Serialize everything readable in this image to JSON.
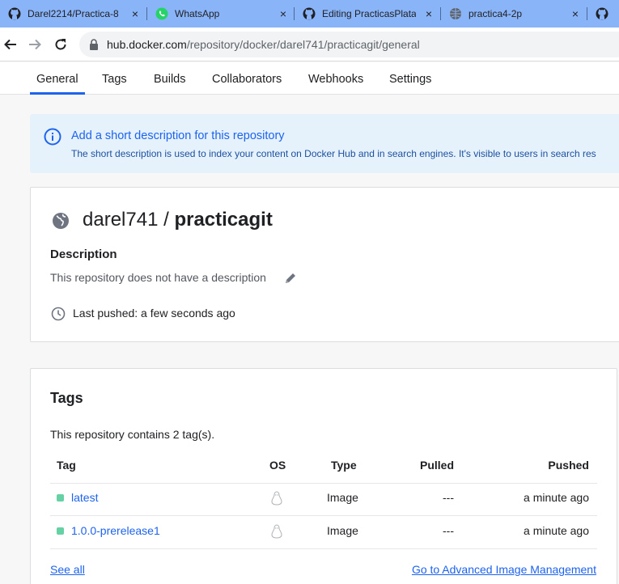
{
  "browser": {
    "tabs": [
      {
        "title": "Darel2214/Practica-8",
        "icon": "github-icon"
      },
      {
        "title": "WhatsApp",
        "icon": "whatsapp-icon"
      },
      {
        "title": "Editing PracticasPlata",
        "icon": "github-icon"
      },
      {
        "title": "practica4-2p",
        "icon": "globe-icon"
      }
    ],
    "close_glyph": "×",
    "url_host": "hub.docker.com",
    "url_path": "/repository/docker/darel741/practicagit/general"
  },
  "repo_nav": {
    "tabs": [
      "General",
      "Tags",
      "Builds",
      "Collaborators",
      "Webhooks",
      "Settings"
    ],
    "active": "General",
    "accent_color": "#1d63ed"
  },
  "banner": {
    "title": "Add a short description for this repository",
    "text": "The short description is used to index your content on Docker Hub and in search engines. It's visible to users in search res"
  },
  "repo": {
    "owner": "darel741",
    "separator": " / ",
    "name": "practicagit",
    "description_heading": "Description",
    "description_text": "This repository does not have a description",
    "last_pushed": "Last pushed: a few seconds ago"
  },
  "tags": {
    "heading": "Tags",
    "count_text": "This repository contains 2 tag(s).",
    "columns": [
      "Tag",
      "OS",
      "Type",
      "Pulled",
      "Pushed"
    ],
    "rows": [
      {
        "tag": "latest",
        "os": "linux-icon",
        "type": "Image",
        "pulled": "---",
        "pushed": "a minute ago"
      },
      {
        "tag": "1.0.0-prerelease1",
        "os": "linux-icon",
        "type": "Image",
        "pulled": "---",
        "pushed": "a minute ago"
      }
    ],
    "see_all": "See all",
    "advanced": "Go to Advanced Image Management",
    "status_color": "#66d1a5"
  }
}
